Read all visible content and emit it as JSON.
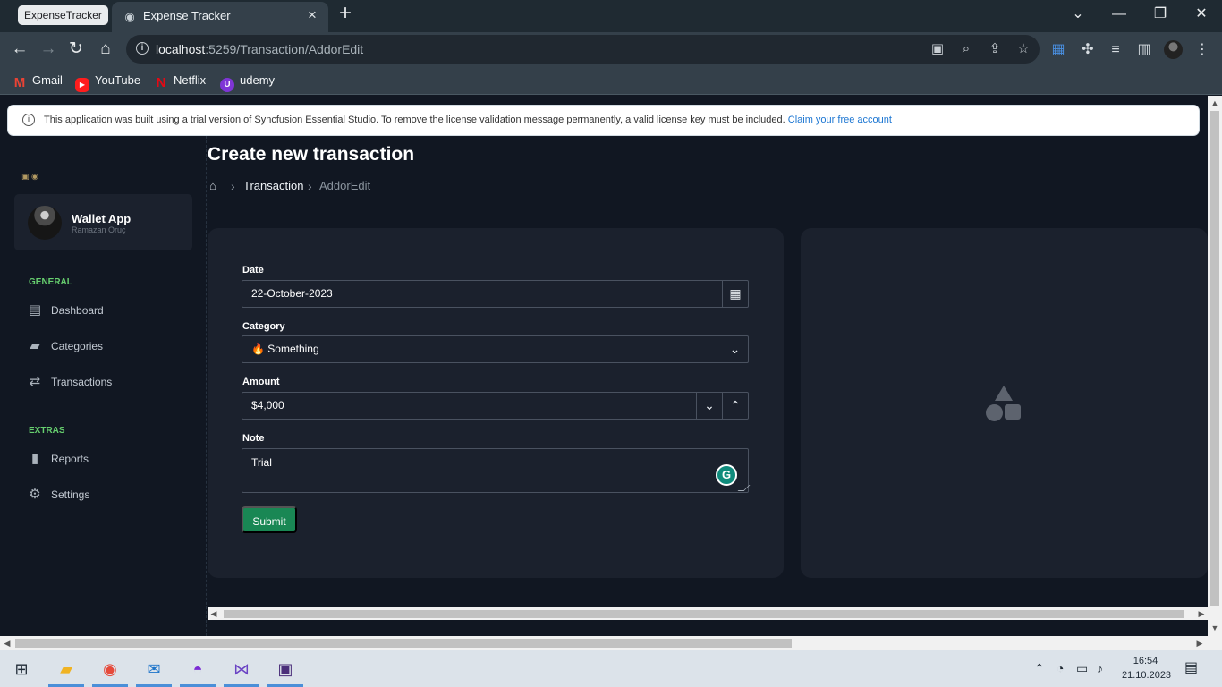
{
  "browser": {
    "tab_group_label": "ExpenseTracker",
    "active_tab_title": "Expense Tracker",
    "url_host": "localhost",
    "url_path": ":5259/Transaction/AddorEdit",
    "bookmarks": [
      {
        "label": "Gmail",
        "icon": "gmail-icon"
      },
      {
        "label": "YouTube",
        "icon": "youtube-icon"
      },
      {
        "label": "Netflix",
        "icon": "netflix-icon"
      },
      {
        "label": "udemy",
        "icon": "udemy-icon"
      }
    ],
    "window_controls": {
      "minimize": "—",
      "restore": "❐",
      "close": "✕",
      "tabs_menu": "⌄"
    }
  },
  "license": {
    "message": "This application was built using a trial version of Syncfusion Essential Studio. To remove the license validation message permanently, a valid license key must be included. ",
    "link": "Claim your free account"
  },
  "sidebar": {
    "profile": {
      "name": "Wallet App",
      "subtitle": "Ramazan Oruç"
    },
    "sections": [
      {
        "title": "GENERAL",
        "items": [
          "Dashboard",
          "Categories",
          "Transactions"
        ]
      },
      {
        "title": "EXTRAS",
        "items": [
          "Reports",
          "Settings"
        ]
      }
    ]
  },
  "page": {
    "title": "Create new transaction",
    "breadcrumb": {
      "link": "Transaction",
      "current": "AddorEdit"
    }
  },
  "form": {
    "date": {
      "label": "Date",
      "value": "22-October-2023"
    },
    "category": {
      "label": "Category",
      "value": "🔥 Something"
    },
    "amount": {
      "label": "Amount",
      "value": "$4,000"
    },
    "note": {
      "label": "Note",
      "value": "Trial"
    },
    "submit_label": "Submit"
  },
  "taskbar": {
    "time": "16:54",
    "date": "21.10.2023"
  },
  "colors": {
    "accent_green": "#67d06f",
    "submit_green": "#198754",
    "link_blue": "#1c76d2",
    "panel_bg": "#1b212d",
    "page_bg": "#111722"
  }
}
